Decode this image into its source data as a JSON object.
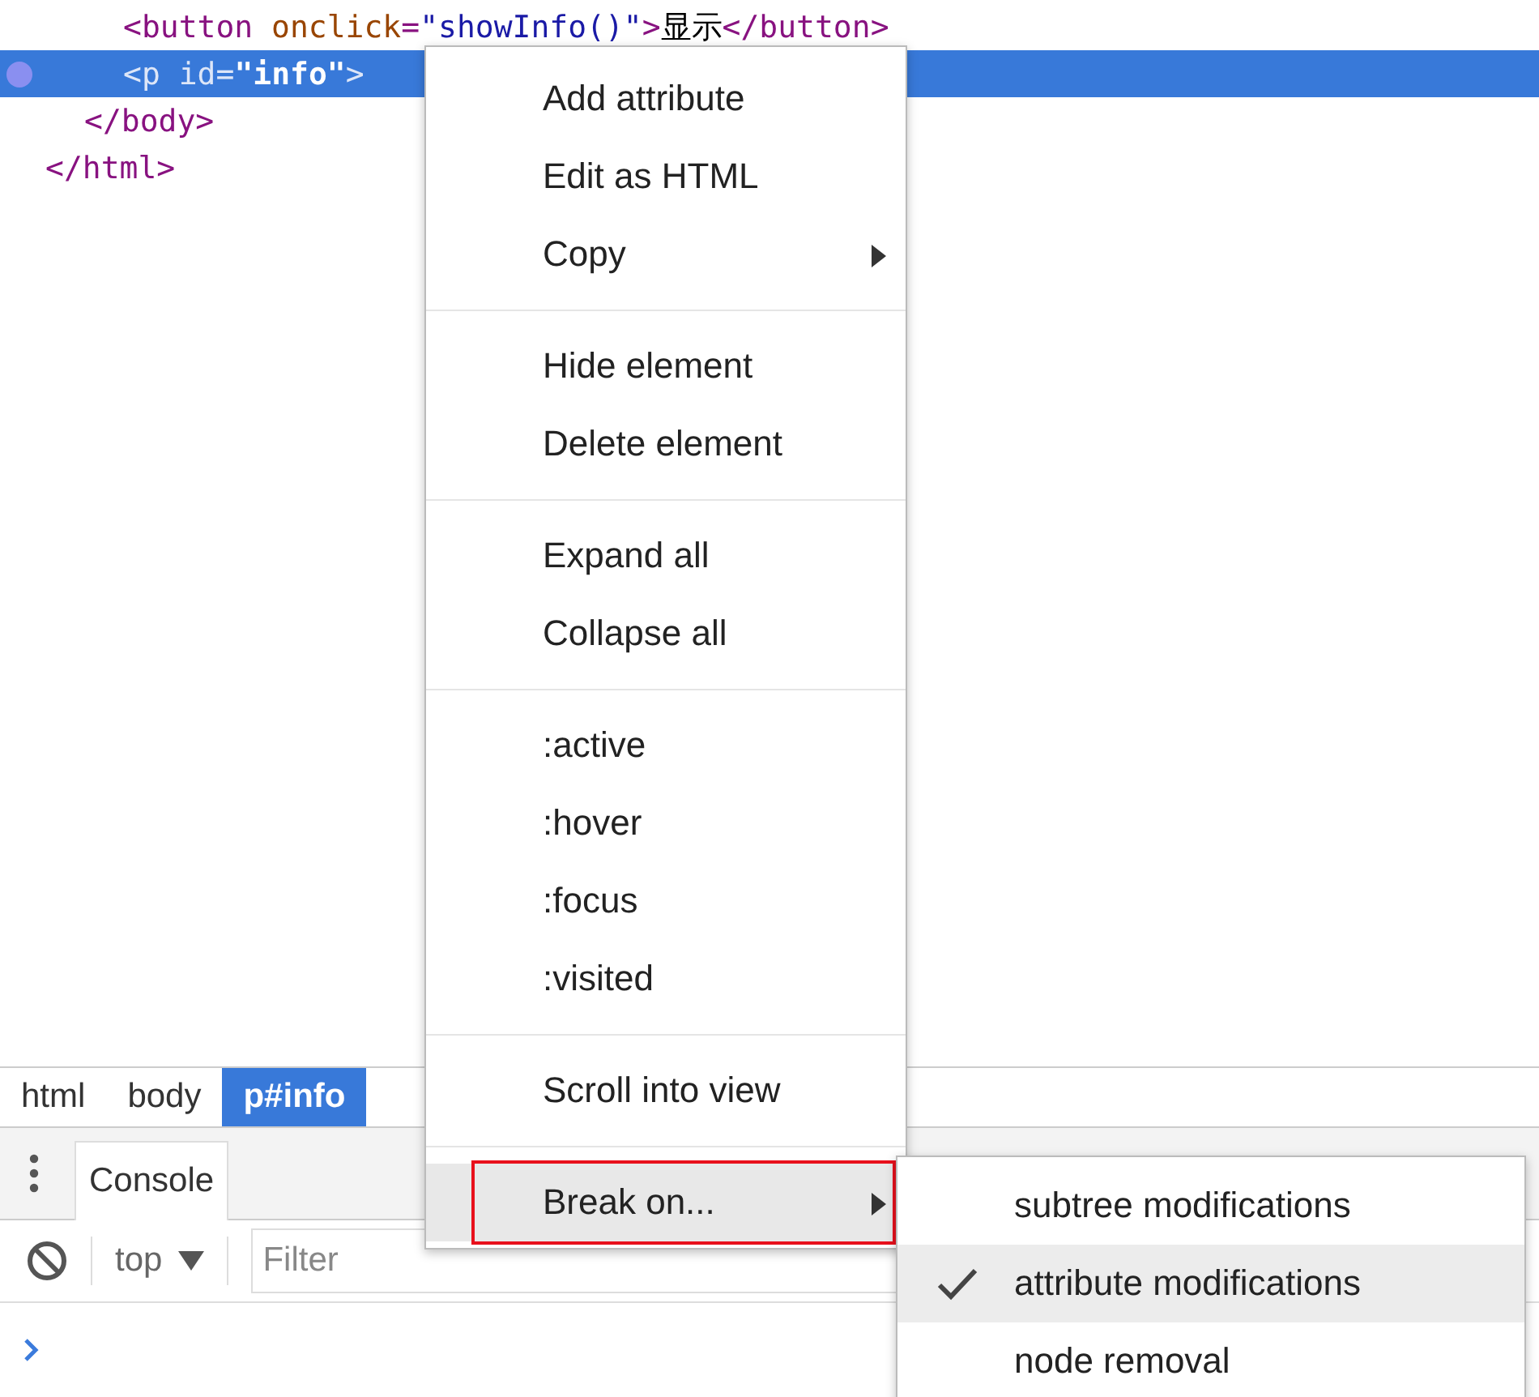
{
  "elements_tree": [
    {
      "children": [
        {
          "children": [
            {
              "text": "<button onclick=\"showInfo()\">显示</button>",
              "selected": false
            },
            {
              "text": "<p id=\"info\">",
              "selected": true
            }
          ]
        },
        {
          "text": "</body>",
          "selected": false
        }
      ]
    },
    {
      "text": "</html>",
      "selected": false
    }
  ],
  "breadcrumbs": [
    {
      "label": "html",
      "selected": false
    },
    {
      "label": "body",
      "selected": false
    },
    {
      "label": "p#info",
      "selected": true
    }
  ],
  "drawer_tabs": [
    {
      "label": "Console",
      "selected": true
    }
  ],
  "console_toolbar": {
    "context": "top",
    "filter": {
      "placeholder": "Filter"
    }
  },
  "context_menu": {
    "groups": [
      [
        {
          "label": "Add attribute",
          "submenu": false,
          "selected": false,
          "outlined": false
        },
        {
          "label": "Edit as HTML",
          "submenu": false,
          "selected": false,
          "outlined": false
        },
        {
          "label": "Copy",
          "submenu": true,
          "selected": false,
          "outlined": false
        }
      ],
      [
        {
          "label": "Hide element",
          "submenu": false,
          "selected": false,
          "outlined": false
        },
        {
          "label": "Delete element",
          "submenu": false,
          "selected": false,
          "outlined": false
        }
      ],
      [
        {
          "label": "Expand all",
          "submenu": false,
          "selected": false,
          "outlined": false
        },
        {
          "label": "Collapse all",
          "submenu": false,
          "selected": false,
          "outlined": false
        }
      ],
      [
        {
          "label": ":active",
          "submenu": false,
          "selected": false,
          "outlined": false
        },
        {
          "label": ":hover",
          "submenu": false,
          "selected": false,
          "outlined": false
        },
        {
          "label": ":focus",
          "submenu": false,
          "selected": false,
          "outlined": false
        },
        {
          "label": ":visited",
          "submenu": false,
          "selected": false,
          "outlined": false
        }
      ],
      [
        {
          "label": "Scroll into view",
          "submenu": false,
          "selected": false,
          "outlined": false
        }
      ],
      [
        {
          "label": "Break on...",
          "submenu": true,
          "selected": true,
          "outlined": true
        }
      ]
    ]
  },
  "submenu": {
    "items": [
      {
        "label": "subtree modifications",
        "checked": false,
        "selected": false
      },
      {
        "label": "attribute modifications",
        "checked": true,
        "selected": true
      },
      {
        "label": "node removal",
        "checked": false,
        "selected": false
      }
    ]
  }
}
